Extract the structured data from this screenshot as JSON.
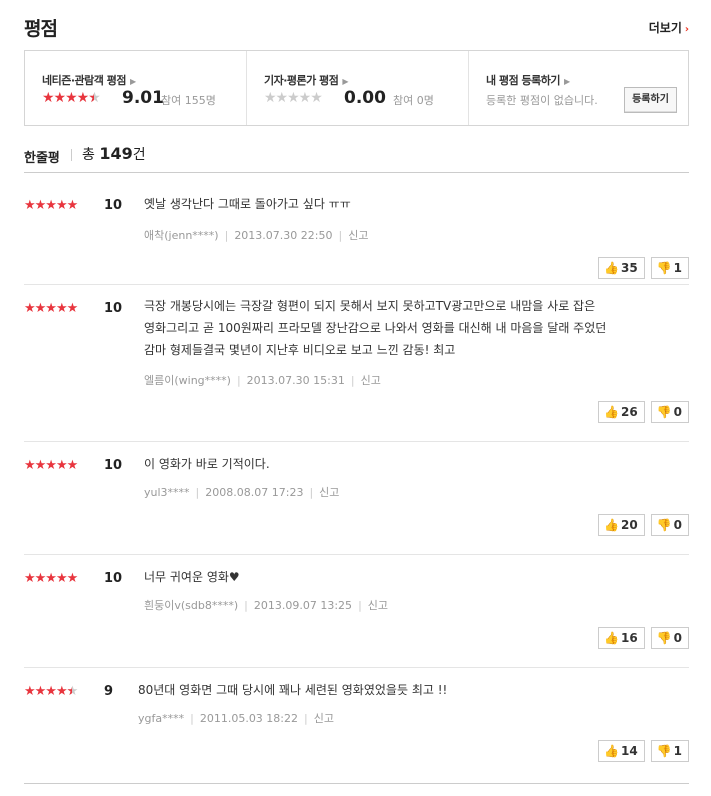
{
  "header": {
    "title": "평점",
    "more": "더보기",
    "more_arrow": "›"
  },
  "summary": {
    "netizen": {
      "label": "네티즌·관람객 평점",
      "stars": "★★★★★",
      "score": "9.01",
      "participants": "참여 155명"
    },
    "critic": {
      "label": "기자·평론가 평점",
      "stars": "★★★★★",
      "score": "0.00",
      "participants": "참여 0명"
    },
    "mine": {
      "label": "내 평점 등록하기",
      "note": "등록한 평점이 없습니다.",
      "register": "등록하기"
    }
  },
  "count": {
    "label": "한줄평",
    "prefix": "총",
    "number": "149",
    "suffix": "건"
  },
  "reviews": [
    {
      "stars": "★★★★★",
      "score": "10",
      "lines": [
        "옛날 생각난다 그때로 돌아가고 싶다 ㅠㅠ"
      ],
      "user": "애착(jenn****)",
      "date": "2013.07.30 22:50",
      "report": "신고",
      "likes": "35",
      "dislikes": "1"
    },
    {
      "stars": "★★★★★",
      "score": "10",
      "lines": [
        "극장 개봉당시에는 극장갈 형편이 되지 못해서 보지 못하고TV광고만으로 내맘을 사로 잡은",
        "영화그리고 곧 100원짜리 프라모델 장난감으로 나와서 영화를 대신해 내 마음을 달래 주었던",
        "감마 형제들결국 몇년이 지난후 비디오로 보고 느낀 감동! 최고"
      ],
      "user": "엘름이(wing****)",
      "date": "2013.07.30 15:31",
      "report": "신고",
      "likes": "26",
      "dislikes": "0"
    },
    {
      "stars": "★★★★★",
      "score": "10",
      "lines": [
        "이 영화가 바로 기적이다."
      ],
      "user": "yul3****",
      "date": "2008.08.07 17:23",
      "report": "신고",
      "likes": "20",
      "dislikes": "0"
    },
    {
      "stars": "★★★★★",
      "score": "10",
      "lines": [
        "너무 귀여운 영화♥"
      ],
      "user": "흰둥이v(sdb8****)",
      "date": "2013.09.07 13:25",
      "report": "신고",
      "likes": "16",
      "dislikes": "0"
    },
    {
      "stars": "★★★★★",
      "score": "9",
      "lines": [
        "80년대 영화면 그때 당시에 꽤나 세련된 영화였었을듯 최고 !!"
      ],
      "user": "ygfa****",
      "date": "2011.05.03 18:22",
      "report": "신고",
      "likes": "14",
      "dislikes": "1"
    }
  ],
  "colors": {
    "star_on": "#e8353e",
    "star_off": "#cccccc",
    "accent": "#ee3322"
  },
  "icons": {
    "like": "thumbs-up-icon",
    "dislike": "thumbs-down-icon"
  }
}
